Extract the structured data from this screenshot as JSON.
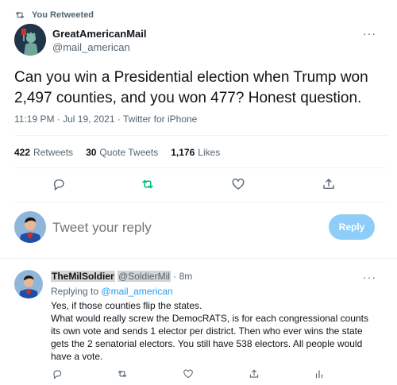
{
  "retweet_banner": {
    "label": "You Retweeted"
  },
  "tweet": {
    "author_name": "GreatAmericanMail",
    "author_handle": "@mail_american",
    "more": "···",
    "text": "Can you win a Presidential election when Trump won 2,497 counties, and you won 477? Honest question.",
    "meta": "11:19 PM · Jul 19, 2021 · Twitter for iPhone",
    "stats": {
      "retweets_count": "422",
      "retweets_label": "Retweets",
      "quote_count": "30",
      "quote_label": "Quote Tweets",
      "likes_count": "1,176",
      "likes_label": "Likes"
    }
  },
  "compose": {
    "placeholder": "Tweet your reply",
    "button": "Reply"
  },
  "reply": {
    "author_name": "TheMilSoldier",
    "author_handle": "@SoldierMil",
    "time": "· 8m",
    "more": "···",
    "replying_prefix": "Replying to",
    "replying_to": "@mail_american",
    "line1": "Yes, if those counties flip the states.",
    "line2": "What would really screw the DemocRATS, is for each congressional counts its own vote and sends 1 elector per district. Then who ever wins the state gets the 2 senatorial electors. You still have 538 electors. All people would have a vote."
  },
  "colors": {
    "accent": "#1d9bf0",
    "retweet_active": "#00ba7c",
    "reply_button": "#8ecdf8",
    "muted": "#536471"
  },
  "icons": [
    "retweet-icon",
    "reply-icon",
    "like-icon",
    "share-icon",
    "analytics-icon"
  ]
}
